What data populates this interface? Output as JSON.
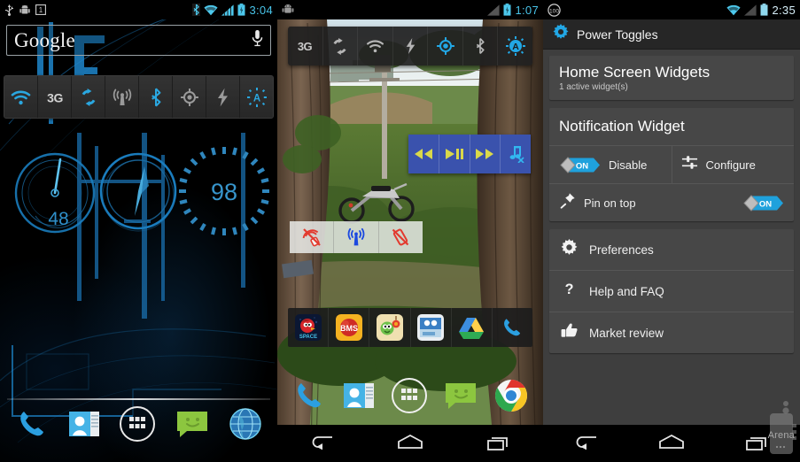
{
  "panel1": {
    "name": "android-homescreen-blue",
    "status": {
      "time": "3:04",
      "left_icons": [
        "usb-icon",
        "android-debug-icon",
        "calendar-icon"
      ],
      "right_icons": [
        "bluetooth-icon",
        "wifi-icon",
        "signal-icon",
        "battery-icon"
      ]
    },
    "search": {
      "label": "Google",
      "mic_icon": "microphone-icon"
    },
    "toggles": [
      {
        "id": "wifi",
        "icon": "wifi-icon",
        "active": true
      },
      {
        "id": "3g",
        "icon": "3g-icon",
        "label": "3G",
        "active": false
      },
      {
        "id": "sync",
        "icon": "sync-icon",
        "active": true
      },
      {
        "id": "mobile-data",
        "icon": "antenna-icon",
        "active": false
      },
      {
        "id": "bluetooth",
        "icon": "bluetooth-icon",
        "active": true
      },
      {
        "id": "gps",
        "icon": "gps-icon",
        "active": false
      },
      {
        "id": "flashlight",
        "icon": "lightning-icon",
        "active": false
      },
      {
        "id": "auto-brightness",
        "icon": "auto-brightness-icon",
        "active": true
      }
    ],
    "gauges": [
      {
        "id": "speed-gauge",
        "value": "48"
      },
      {
        "id": "compass-gauge",
        "value": ""
      },
      {
        "id": "battery-gauge",
        "value": "98"
      }
    ],
    "dock": [
      {
        "id": "phone",
        "icon": "phone-icon"
      },
      {
        "id": "contacts",
        "icon": "contacts-icon"
      },
      {
        "id": "app-drawer",
        "icon": "apps-grid-icon"
      },
      {
        "id": "messaging",
        "icon": "message-icon"
      },
      {
        "id": "browser",
        "icon": "globe-icon"
      }
    ]
  },
  "panel2": {
    "name": "android-homescreen-photo",
    "status": {
      "time": "1:07",
      "left_icons": [
        "android-icon"
      ],
      "right_icons": [
        "signal-icon",
        "battery-icon"
      ]
    },
    "toggles": [
      {
        "id": "3g",
        "icon": "3g-icon",
        "label": "3G",
        "active": false
      },
      {
        "id": "sync",
        "icon": "sync-icon",
        "active": false
      },
      {
        "id": "wifi",
        "icon": "wifi-icon",
        "active": false
      },
      {
        "id": "flashlight",
        "icon": "lightning-icon",
        "active": false
      },
      {
        "id": "gps",
        "icon": "gps-icon",
        "active": true
      },
      {
        "id": "bluetooth",
        "icon": "bluetooth-icon",
        "active": false
      },
      {
        "id": "auto-brightness",
        "icon": "auto-brightness-icon",
        "active": true
      }
    ],
    "media_controls": [
      {
        "id": "previous",
        "icon": "rewind-icon"
      },
      {
        "id": "play-pause",
        "icon": "play-pause-icon"
      },
      {
        "id": "next",
        "icon": "fast-forward-icon"
      },
      {
        "id": "mute",
        "icon": "music-mute-icon"
      }
    ],
    "mini_widget": [
      {
        "id": "ringer-off",
        "icon": "ringer-off-icon",
        "color": "#e33a2e"
      },
      {
        "id": "mobile-data",
        "icon": "antenna-icon",
        "color": "#1b49e0"
      },
      {
        "id": "vibrate-off",
        "icon": "vibrate-off-icon",
        "color": "#e33a2e"
      }
    ],
    "app_shortcuts": [
      {
        "id": "angry-birds-space",
        "icon": "angry-birds-icon",
        "label": "SPACE"
      },
      {
        "id": "bms",
        "icon": "bms-icon",
        "label": "BMS"
      },
      {
        "id": "cut-the-rope",
        "icon": "cut-the-rope-icon"
      },
      {
        "id": "photo-app",
        "icon": "photo-app-icon"
      },
      {
        "id": "google-drive",
        "icon": "drive-icon"
      },
      {
        "id": "phone",
        "icon": "phone-icon"
      }
    ],
    "dock": [
      {
        "id": "phone",
        "icon": "phone-icon"
      },
      {
        "id": "contacts",
        "icon": "contacts-icon"
      },
      {
        "id": "app-drawer",
        "icon": "apps-grid-icon"
      },
      {
        "id": "messaging",
        "icon": "message-icon"
      },
      {
        "id": "chrome",
        "icon": "chrome-icon"
      }
    ]
  },
  "panel3": {
    "name": "power-toggles-settings",
    "status": {
      "time": "2:35",
      "left_icons": [
        "battery-100-badge"
      ],
      "badge": "100",
      "right_icons": [
        "wifi-icon",
        "signal-icon",
        "battery-icon"
      ]
    },
    "app": {
      "title": "Power Toggles",
      "icon": "gear-icon"
    },
    "sections": {
      "home_widgets": {
        "title": "Home Screen Widgets",
        "subtitle": "1 active widget(s)"
      },
      "notification_widget": {
        "title": "Notification Widget"
      }
    },
    "rows": [
      {
        "id": "disable",
        "label": "Disable",
        "toggle": "ON",
        "icon": "toggle-switch"
      },
      {
        "id": "configure",
        "label": "Configure",
        "icon": "sliders-icon"
      },
      {
        "id": "pin-on-top",
        "label": "Pin on top",
        "toggle": "ON",
        "icon": "pushpin-icon"
      }
    ],
    "menu": [
      {
        "id": "preferences",
        "label": "Preferences",
        "icon": "gear-icon"
      },
      {
        "id": "help-and-faq",
        "label": "Help and FAQ",
        "icon": "question-mark-icon"
      },
      {
        "id": "market-review",
        "label": "Market review",
        "icon": "thumbs-up-icon"
      }
    ]
  },
  "navbar": {
    "back": "back-icon",
    "home": "home-icon",
    "recents": "recents-icon"
  },
  "watermark": {
    "text": "Arena",
    "prefix": "phone"
  },
  "colors": {
    "accent_blue": "#29abe2",
    "toggle_on": "#1fa1dc",
    "status_cyan": "#48c3e8",
    "media_blue": "#3a52ad",
    "media_yellow": "#d9d84a",
    "card_bg": "#474747",
    "app_bg": "#3e3e3e"
  }
}
